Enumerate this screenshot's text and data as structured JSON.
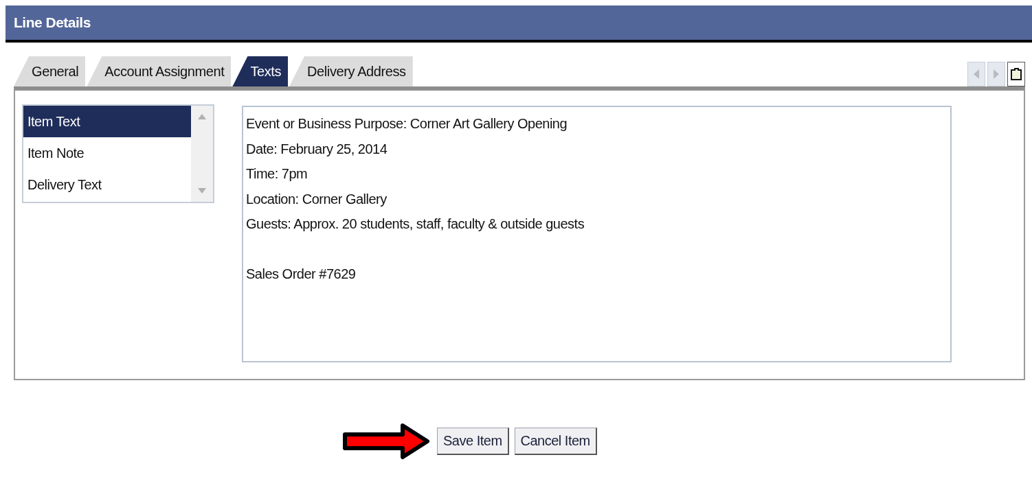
{
  "window": {
    "title": "Line Details"
  },
  "tabs": [
    {
      "label": "General",
      "selected": false
    },
    {
      "label": "Account Assignment",
      "selected": false
    },
    {
      "label": "Texts",
      "selected": true
    },
    {
      "label": "Delivery Address",
      "selected": false
    }
  ],
  "text_types": [
    {
      "label": "Item Text",
      "selected": true
    },
    {
      "label": "Item Note",
      "selected": false
    },
    {
      "label": "Delivery Text",
      "selected": false
    }
  ],
  "text_field": {
    "value": "Event or Business Purpose: Corner Art Gallery Opening\nDate: February 25, 2014\nTime: 7pm\nLocation: Corner Gallery\nGuests: Approx. 20 students, staff, faculty & outside guests\n\nSales Order #7629"
  },
  "buttons": [
    "Save Item",
    "Cancel Item"
  ]
}
